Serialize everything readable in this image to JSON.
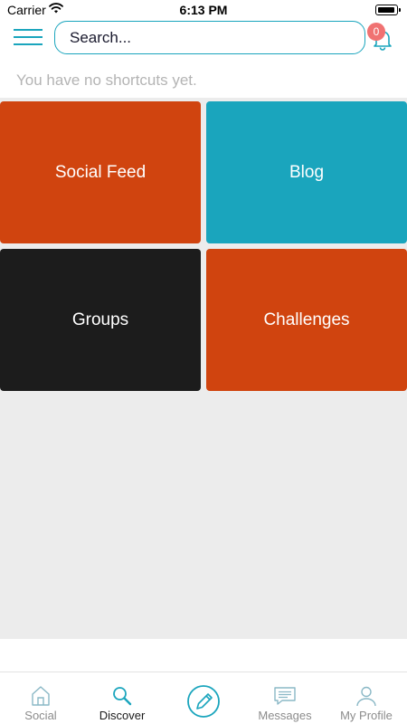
{
  "status_bar": {
    "carrier": "Carrier",
    "time": "6:13 PM"
  },
  "header": {
    "search_placeholder": "Search...",
    "notification_count": "0"
  },
  "shortcuts": {
    "empty_message": "You have no shortcuts yet."
  },
  "tiles": [
    {
      "label": "Social Feed",
      "color": "#d0440f"
    },
    {
      "label": "Blog",
      "color": "#1aa5bd"
    },
    {
      "label": "Groups",
      "color": "#1c1c1c"
    },
    {
      "label": "Challenges",
      "color": "#d0440f"
    }
  ],
  "tab_bar": {
    "items": [
      {
        "label": "Social",
        "icon": "home-icon",
        "active": false
      },
      {
        "label": "Discover",
        "icon": "search-icon",
        "active": true
      },
      {
        "label": "",
        "icon": "compose-icon",
        "active": false
      },
      {
        "label": "Messages",
        "icon": "messages-icon",
        "active": false
      },
      {
        "label": "My Profile",
        "icon": "profile-icon",
        "active": false
      }
    ]
  },
  "colors": {
    "accent": "#1aa5bd",
    "badge": "#f07272",
    "orange": "#d0440f",
    "dark": "#1c1c1c",
    "grid_bg": "#ececec"
  }
}
